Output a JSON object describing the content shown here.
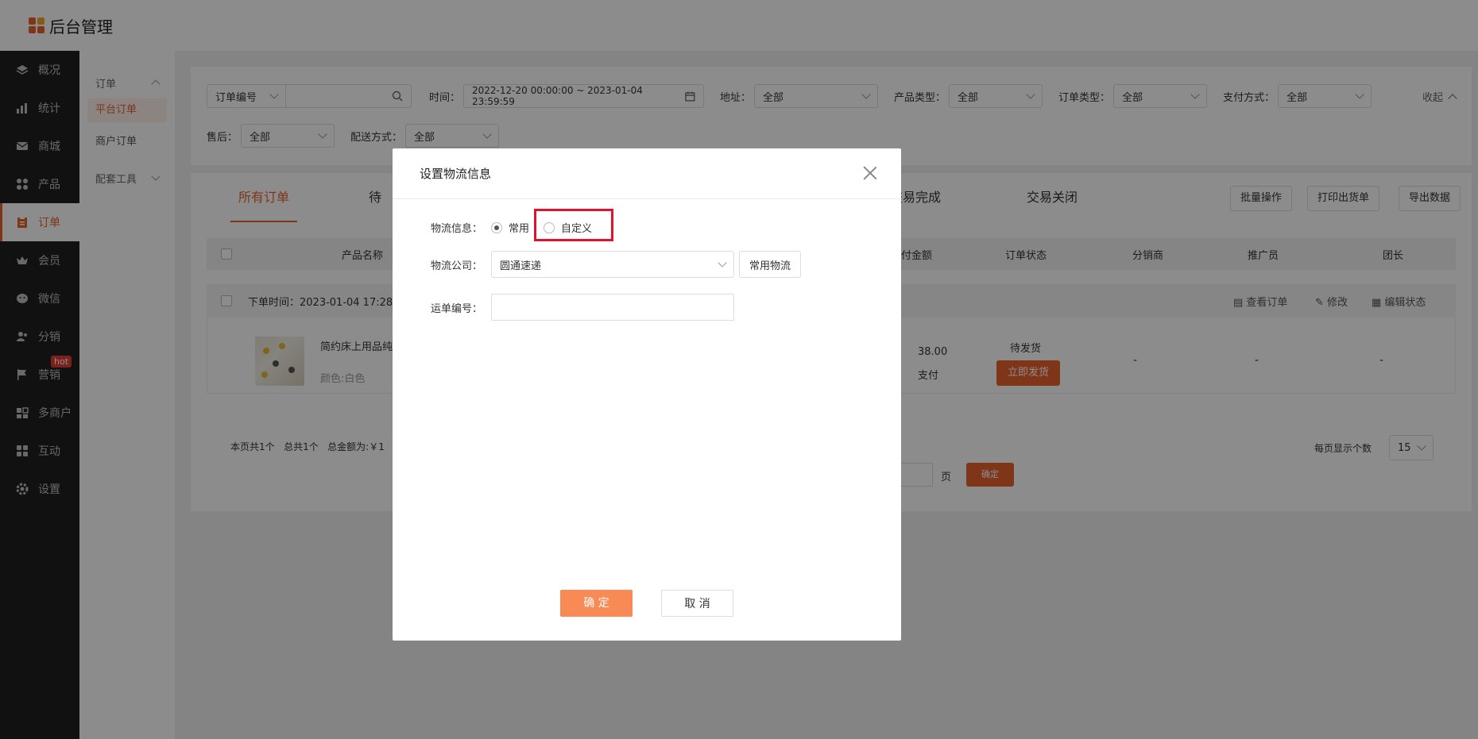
{
  "app": {
    "title": "后台管理"
  },
  "sidebar": {
    "items": [
      {
        "label": "概况",
        "icon": "layers-icon"
      },
      {
        "label": "统计",
        "icon": "chart-icon"
      },
      {
        "label": "商城",
        "icon": "mail-icon"
      },
      {
        "label": "产品",
        "icon": "grid-icon"
      },
      {
        "label": "订单",
        "icon": "clipboard-icon",
        "active": true
      },
      {
        "label": "会员",
        "icon": "crown-icon"
      },
      {
        "label": "微信",
        "icon": "wechat-icon"
      },
      {
        "label": "分销",
        "icon": "users-icon"
      },
      {
        "label": "营销",
        "icon": "flag-icon",
        "badge": "hot"
      },
      {
        "label": "多商户",
        "icon": "store-icon"
      },
      {
        "label": "互动",
        "icon": "apps-icon"
      },
      {
        "label": "设置",
        "icon": "gear-icon"
      }
    ]
  },
  "subnav": {
    "group": "订单",
    "items": [
      "平台订单",
      "商户订单"
    ],
    "group2": "配套工具"
  },
  "filters": {
    "search_type": "订单编号",
    "time_label": "时间：",
    "time_value": "2022-12-20 00:00:00 ~ 2023-01-04 23:59:59",
    "address_label": "地址：",
    "address_value": "全部",
    "product_type_label": "产品类型：",
    "product_type_value": "全部",
    "order_type_label": "订单类型：",
    "order_type_value": "全部",
    "payment_label": "支付方式：",
    "payment_value": "全部",
    "collapse": "收起",
    "aftersale_label": "售后：",
    "aftersale_value": "全部",
    "delivery_label": "配送方式：",
    "delivery_value": "全部"
  },
  "tabs": [
    "所有订单",
    "待",
    "交易完成",
    "交易关闭"
  ],
  "actions": {
    "batch": "批量操作",
    "print": "打印出货单",
    "export": "导出数据"
  },
  "table": {
    "headers": [
      "产品名称",
      "付金额",
      "订单状态",
      "分销商",
      "推广员",
      "团长"
    ],
    "order": {
      "time": "下单时间：2023-01-04 17:28",
      "links": [
        "查看订单",
        "修改",
        "编辑状态"
      ],
      "product_name": "简约床上用品纯",
      "variant": "颜色:白色",
      "amount": "38.00",
      "pay_status": "支付",
      "status": "待发货",
      "ship_btn": "立即发货",
      "dist": "-",
      "promoter": "-",
      "leader": "-"
    }
  },
  "footer": {
    "summary": "本页共1个   总共1个   总金额为:￥1",
    "page_unit": "页",
    "confirm": "确定",
    "per_page_label": "每页显示个数",
    "per_page_value": "15"
  },
  "modal": {
    "title": "设置物流信息",
    "info_label": "物流信息：",
    "opt_common": "常用",
    "opt_custom": "自定义",
    "company_label": "物流公司：",
    "company_value": "圆通速递",
    "common_btn": "常用物流",
    "tracking_label": "运单编号：",
    "tracking_value": "",
    "ok": "确 定",
    "cancel": "取 消"
  }
}
